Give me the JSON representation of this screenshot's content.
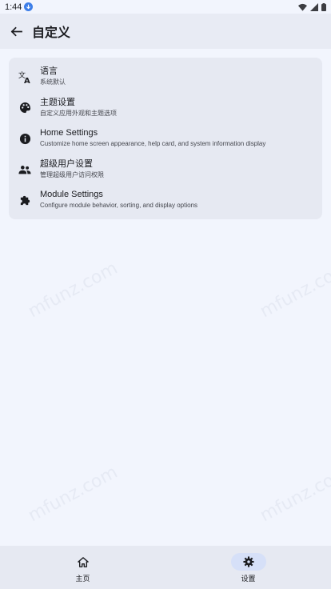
{
  "status_bar": {
    "time": "1:44"
  },
  "header": {
    "title": "自定义",
    "back_icon": "arrow-back-icon"
  },
  "settings": [
    {
      "id": "language",
      "title": "语言",
      "subtitle": "系统默认",
      "icon": "translate-icon"
    },
    {
      "id": "theme",
      "title": "主题设置",
      "subtitle": "自定义应用外观和主题选项",
      "icon": "palette-icon"
    },
    {
      "id": "home",
      "title": "Home Settings",
      "subtitle": "Customize home screen appearance, help card, and system information display",
      "icon": "info-icon"
    },
    {
      "id": "superuser",
      "title": "超级用户设置",
      "subtitle": "管理超级用户访问权限",
      "icon": "people-icon"
    },
    {
      "id": "module",
      "title": "Module Settings",
      "subtitle": "Configure module behavior, sorting, and display options",
      "icon": "puzzle-icon"
    }
  ],
  "bottom_nav": [
    {
      "label": "主页",
      "icon": "home-icon",
      "active": false
    },
    {
      "label": "设置",
      "icon": "gear-icon",
      "active": true
    }
  ],
  "watermark": "mfunz.com",
  "colors": {
    "background": "#f2f5fd",
    "card": "#e6e9f2",
    "active_pill": "#d6e0f8"
  }
}
